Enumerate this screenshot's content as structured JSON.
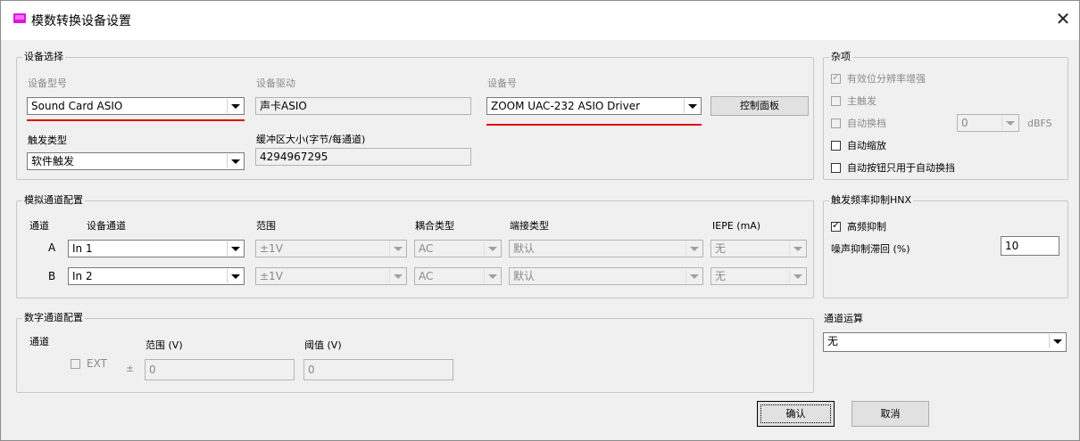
{
  "window": {
    "title": "模数转换设备设置",
    "close_symbol": "✕"
  },
  "device_select": {
    "legend": "设备选择",
    "model_label": "设备型号",
    "model_value": "Sound Card ASIO",
    "driver_label": "设备驱动",
    "driver_value": "声卡ASIO",
    "device_no_label": "设备号",
    "device_no_value": "ZOOM UAC-232 ASIO Driver",
    "control_panel_label": "控制面板",
    "trigger_type_label": "触发类型",
    "trigger_type_value": "软件触发",
    "buffer_label": "缓冲区大小(字节/每通道)",
    "buffer_value": "4294967295"
  },
  "misc": {
    "legend": "杂项",
    "effective_bits": "有效位分辨率增强",
    "master_trigger": "主触发",
    "auto_range": "自动换档",
    "auto_range_value": "0",
    "auto_range_unit": "dBFS",
    "auto_scale": "自动缩放",
    "auto_button_only": "自动按钮只用于自动换挡"
  },
  "analog": {
    "legend": "模拟通道配置",
    "headers": {
      "channel": "通道",
      "device_channel": "设备通道",
      "range": "范围",
      "coupling": "耦合类型",
      "terminal": "端接类型",
      "iepe": "IEPE (mA)"
    },
    "rows": [
      {
        "channel": "A",
        "device_channel": "In 1",
        "range": "±1V",
        "coupling": "AC",
        "terminal": "默认",
        "iepe": "无"
      },
      {
        "channel": "B",
        "device_channel": "In 2",
        "range": "±1V",
        "coupling": "AC",
        "terminal": "默认",
        "iepe": "无"
      }
    ]
  },
  "trigger_hnx": {
    "legend": "触发频率抑制HNX",
    "hf_reject": "高频抑制",
    "noise_label": "噪声抑制滞回 (%)",
    "noise_value": "10"
  },
  "digital": {
    "legend": "数字通道配置",
    "channel_label": "通道",
    "range_label": "范围 (V)",
    "threshold_label": "阈值 (V)",
    "ext_label": "EXT",
    "pm": "±",
    "range_value": "0",
    "threshold_value": "0"
  },
  "channel_calc": {
    "label": "通道运算",
    "value": "无"
  },
  "buttons": {
    "ok": "确认",
    "cancel": "取消"
  },
  "colors": {
    "underline": "#e00000",
    "app_icon": "#d81bd8"
  }
}
